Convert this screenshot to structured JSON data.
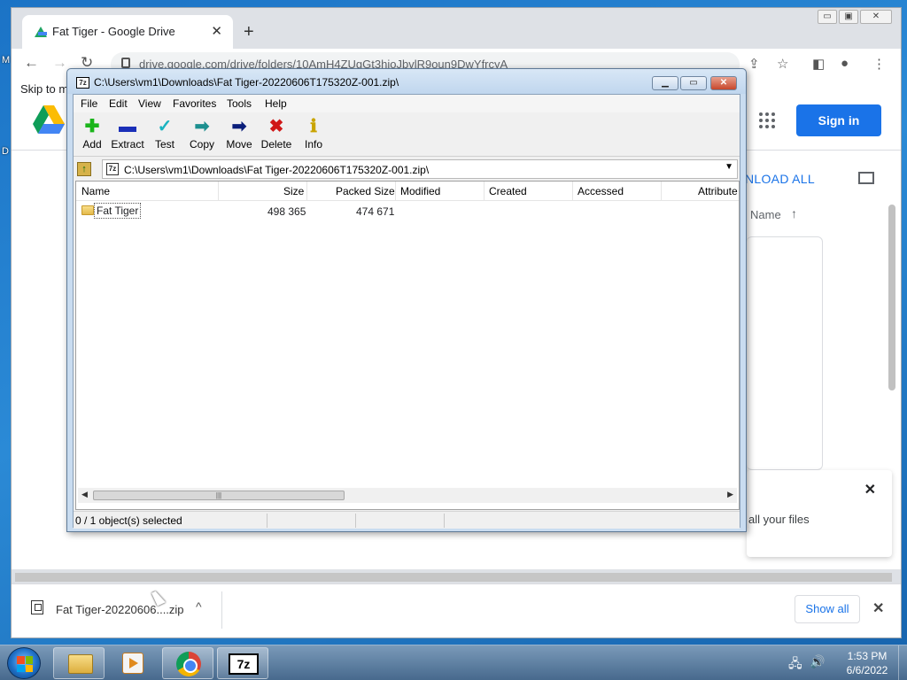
{
  "desktop": {
    "frag1": "M",
    "frag2": "D"
  },
  "chrome": {
    "tab_title": "Fat Tiger - Google Drive",
    "tab_close": "✕",
    "new_tab": "+",
    "url": "drive.google.com/drive/folders/10AmH4ZUgGt3hioJbvlR9oun9DwYfrcyA",
    "window_controls": {
      "minimize": "▭",
      "maximize": "▣",
      "close": "✕"
    }
  },
  "drive": {
    "skip_link": "Skip to m",
    "sign_in": "Sign in",
    "download_all": "NLOAD ALL",
    "sort_label": "Name",
    "sort_arrow": "↑",
    "toast_text": "all your files",
    "toast_close": "✕"
  },
  "downloads": {
    "file_name": "Fat Tiger-20220606....zip",
    "chevron": "^",
    "show_all": "Show all",
    "close": "✕"
  },
  "sevenzip": {
    "title": "C:\\Users\\vm1\\Downloads\\Fat Tiger-20220606T175320Z-001.zip\\",
    "icon_text": "7z",
    "menu": [
      "File",
      "Edit",
      "View",
      "Favorites",
      "Tools",
      "Help"
    ],
    "toolbar": [
      {
        "label": "Add",
        "glyph": "✚",
        "color": "#1bb51b"
      },
      {
        "label": "Extract",
        "glyph": "▬",
        "color": "#1a2fb8"
      },
      {
        "label": "Test",
        "glyph": "✓",
        "color": "#19b3c0"
      },
      {
        "label": "Copy",
        "glyph": "➡",
        "color": "#1c8f8f"
      },
      {
        "label": "Move",
        "glyph": "➡",
        "color": "#0a1e7a"
      },
      {
        "label": "Delete",
        "glyph": "✖",
        "color": "#d01818"
      },
      {
        "label": "Info",
        "glyph": "ℹ",
        "color": "#c9a400"
      }
    ],
    "path": "C:\\Users\\vm1\\Downloads\\Fat Tiger-20220606T175320Z-001.zip\\",
    "columns": [
      "Name",
      "Size",
      "Packed Size",
      "Modified",
      "Created",
      "Accessed",
      "Attribute"
    ],
    "rows": [
      {
        "name": "Fat Tiger",
        "size": "498 365",
        "packed": "474 671"
      }
    ],
    "status": "0 / 1 object(s) selected",
    "window_controls": {
      "minimize": "▁",
      "maximize": "▭",
      "close": "✕"
    }
  },
  "taskbar": {
    "time": "1:53 PM",
    "date": "6/6/2022",
    "sevenzip_label": "7z"
  }
}
